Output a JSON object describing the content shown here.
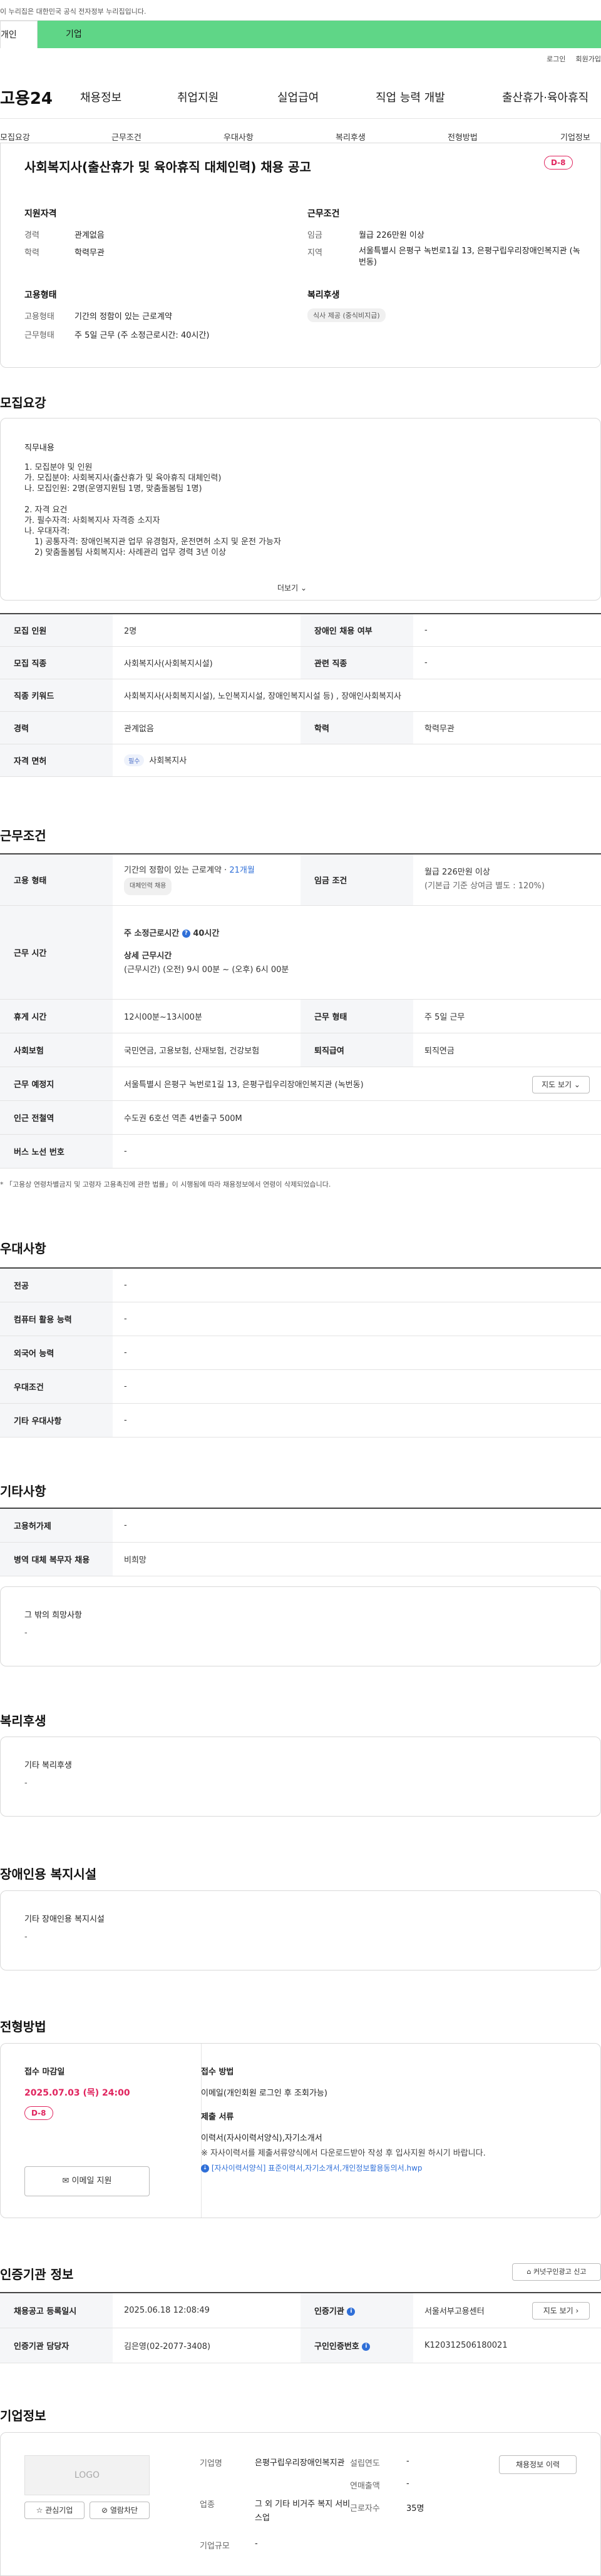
{
  "gov_banner": "이 누리집은 대한민국 공식 전자정부 누리집입니다.",
  "tabs": {
    "person": "개인",
    "company": "기업"
  },
  "top_links": {
    "login": "로그인",
    "join": "회원가입"
  },
  "gnb": {
    "logo": "고용24",
    "items": [
      "채용정보",
      "취업지원",
      "실업급여",
      "직업 능력 개발",
      "출산휴가·육아휴직"
    ]
  },
  "subnav": [
    "모집요강",
    "근무조건",
    "우대사항",
    "복리후생",
    "전형방법",
    "기업정보"
  ],
  "job": {
    "title": "사회복지사(출산휴가 및 육아휴직 대체인력) 채용 공고",
    "dday": "D-8",
    "qual_title": "지원자격",
    "qual_rows": [
      {
        "label": "경력",
        "value": "관계없음"
      },
      {
        "label": "학력",
        "value": "학력무관"
      }
    ],
    "cond_title": "근무조건",
    "cond_wage_label": "임금",
    "cond_wage_value": "월급 226만원 이상",
    "cond_loc_label": "지역",
    "cond_loc_value": "서울특별시 은평구 녹번로1길 13, 은평구립우리장애인복지관 (녹번동)",
    "emp_title": "고용형태",
    "emp_rows": [
      {
        "label": "고용형태",
        "value": "기간의 정함이 있는 근로계약"
      },
      {
        "label": "근무형태",
        "value": "주 5일 근무 (주 소정근로시간: 40시간)"
      }
    ],
    "welfare_title": "복리후생",
    "welfare_chip": "식사 제공 (중식비지급)"
  },
  "recruit": {
    "section_title": "모집요강",
    "desc_title": "직무내용",
    "desc_lines": [
      "1. 모집분야 및 인원",
      "가. 모집분야: 사회복지사(출산휴가 및 육아휴직 대체인력)",
      "나. 모집인원: 2명(운영지원팀 1명, 맞춤돌봄팀 1명)",
      "",
      "2. 자격 요건",
      "가. 필수자격: 사회복지사 자격증 소지자",
      "나. 우대자격:",
      "   1) 공통자격: 장애인복지관 업무 유경험자, 운전면허 소지 및 운전 가능자",
      "   2) 맞춤돌봄팀 사회복지사: 사례관리 업무 경력 3년 이상"
    ],
    "more": "더보기",
    "table": {
      "count_label": "모집 인원",
      "count_value": "2명",
      "disabled_label": "장애인 채용 여부",
      "disabled_value": "-",
      "job_label": "모집 직종",
      "job_value": "사회복지사(사회복지시설)",
      "related_label": "관련 직종",
      "related_value": "-",
      "keyword_label": "직종 키워드",
      "keyword_value": "사회복지사(사회복지시설), 노인복지시설, 장애인복지시설 등) , 장애인사회복지사",
      "career_label": "경력",
      "career_value": "관계없음",
      "edu_label": "학력",
      "edu_value": "학력무관",
      "license_label": "자격 면허",
      "license_chip": "필수",
      "license_value": "사회복지사"
    }
  },
  "conditions": {
    "section_title": "근무조건",
    "emp_label": "고용 형태",
    "emp_value": "기간의 정함이 있는 근로계약 · ",
    "emp_months": "21개월",
    "emp_chip": "대체인력 채용",
    "wage_label": "임금 조건",
    "wage_value": "월급 226만원 이상",
    "wage_sub": "(기본급 기준 상여금 별도 : 120%)",
    "hours_label": "근무 시간",
    "hours_week": "주 소정근로시간",
    "hours_week_value": "40시간",
    "hours_detail_title": "상세 근무시간",
    "hours_detail_value": "(근무시간) (오전) 9시 00분 ~ (오후) 6시 00분",
    "break_label": "휴게 시간",
    "break_value": "12시00분~13시00분",
    "worktype_label": "근무 형태",
    "worktype_value": "주 5일 근무",
    "insurance_label": "사회보험",
    "insurance_value": "국민연금, 고용보험, 산재보험, 건강보험",
    "pension_label": "퇴직급여",
    "pension_value": "퇴직연금",
    "place_label": "근무 예정지",
    "place_value": "서울특별시 은평구 녹번로1길 13, 은평구립우리장애인복지관 (녹번동)",
    "map_button": "지도 보기",
    "station_label": "인근 전철역",
    "station_value": "수도권 6호선 역촌 4번출구 500M",
    "bus_label": "버스 노선 번호",
    "bus_value": "-",
    "footnote": "「고용상 연령차별금지 및 고령자 고용촉진에 관한 법률」이 시행됨에 따라 채용정보에서 연령이 삭제되었습니다."
  },
  "preference": {
    "section_title": "우대사항",
    "rows": [
      {
        "label": "전공",
        "value": "-"
      },
      {
        "label": "컴퓨터 활용 능력",
        "value": "-"
      },
      {
        "label": "외국어 능력",
        "value": "-"
      },
      {
        "label": "우대조건",
        "value": "-"
      },
      {
        "label": "기타 우대사항",
        "value": "-"
      }
    ]
  },
  "etc": {
    "section_title": "기타사항",
    "rows": [
      {
        "label": "고용허가제",
        "value": "-"
      },
      {
        "label": "병역 대체 복무자 채용",
        "value": "비희망"
      }
    ],
    "other_title": "그 밖의 희망사항",
    "other_value": "-"
  },
  "benefits": {
    "section_title": "복리후생",
    "box_title": "기타 복리후생",
    "box_value": "-"
  },
  "facilities": {
    "section_title": "장애인용 복지시설",
    "box_title": "기타 장애인용 복지시설",
    "box_value": "-"
  },
  "selection": {
    "section_title": "전형방법",
    "deadline_title": "접수 마감일",
    "deadline_value": "2025.07.03 (목) 24:00",
    "dday": "D-8",
    "apply_button": "이메일 지원",
    "method_title": "접수 방법",
    "method_value": "이메일(개인회원 로그인 후 조회가능)",
    "docs_title": "제출 서류",
    "docs_value": "이력서(자사이력서양식),자기소개서",
    "docs_note": "※ 자사이력서를 제출서류양식에서 다운로드받아 작성 후 입사지원 하시기 바랍니다.",
    "docs_link": "[자사이력서양식] 표준이력서,자기소개서,개인정보활용동의서.hwp"
  },
  "certification": {
    "section_title": "인증기관 정보",
    "move_button": "커넛구인광고 신고",
    "reg_date_label": "채용공고 등록일시",
    "reg_date_value": "2025.06.18 12:08:49",
    "org_label": "인증기관",
    "org_value": "서울서부고용센터",
    "map_button": "지도 보기",
    "manager_label": "인증기관 담당자",
    "manager_value": "김은영(02-2077-3408)",
    "number_label": "구인인증번호",
    "number_value": "K120312506180021"
  },
  "company": {
    "section_title": "기업정보",
    "logo_text": "LOGO",
    "interest_button": "관심기업",
    "block_button": "열람차단",
    "name_label": "기업명",
    "name_value": "은평구립우리장애인복지관",
    "founded_label": "설립연도",
    "founded_value": "-",
    "industry_label": "업종",
    "industry_value": "그 외 기타 비거주 복지 서비스업",
    "sales_label": "연매출액",
    "sales_value": "-",
    "employees_label": "근로자수",
    "employees_value": "35명",
    "scale_label": "기업규모",
    "scale_value": "-",
    "jobs_button": "채용정보 이력"
  }
}
